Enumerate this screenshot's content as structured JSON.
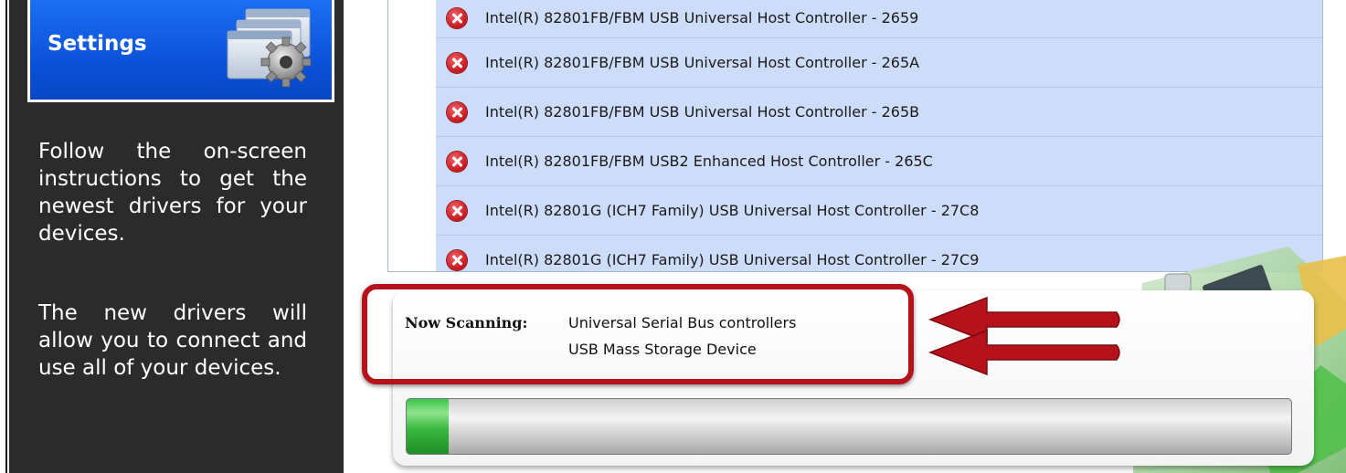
{
  "sidebar": {
    "settings_label": "Settings",
    "paragraph1": "Follow the on-screen instructions to get the newest drivers for your devices.",
    "paragraph2": "The new drivers will allow you to connect and use all of your devices."
  },
  "devices": [
    {
      "name": "Intel(R) 82801FB/FBM USB Universal Host Controller - 2659",
      "status": "error"
    },
    {
      "name": "Intel(R) 82801FB/FBM USB Universal Host Controller - 265A",
      "status": "error"
    },
    {
      "name": "Intel(R) 82801FB/FBM USB Universal Host Controller - 265B",
      "status": "error"
    },
    {
      "name": "Intel(R) 82801FB/FBM USB2 Enhanced Host Controller - 265C",
      "status": "error"
    },
    {
      "name": "Intel(R) 82801G (ICH7 Family) USB Universal Host Controller - 27C8",
      "status": "error"
    },
    {
      "name": "Intel(R) 82801G (ICH7 Family) USB Universal Host Controller - 27C9",
      "status": "error"
    }
  ],
  "scanning": {
    "label": "Now Scanning:",
    "category": "Universal Serial Bus controllers",
    "device": "USB Mass Storage Device"
  },
  "progress": {
    "fraction": 0.048
  },
  "colors": {
    "tile_blue": "#0a55e0",
    "highlight_red": "#b5121b",
    "row_blue": "#cddcf8",
    "progress_green": "#38b83f"
  },
  "icons": {
    "settings": "settings-windows-gear-icon",
    "error": "error-x-icon",
    "arrow": "red-arrow-left-icon"
  }
}
